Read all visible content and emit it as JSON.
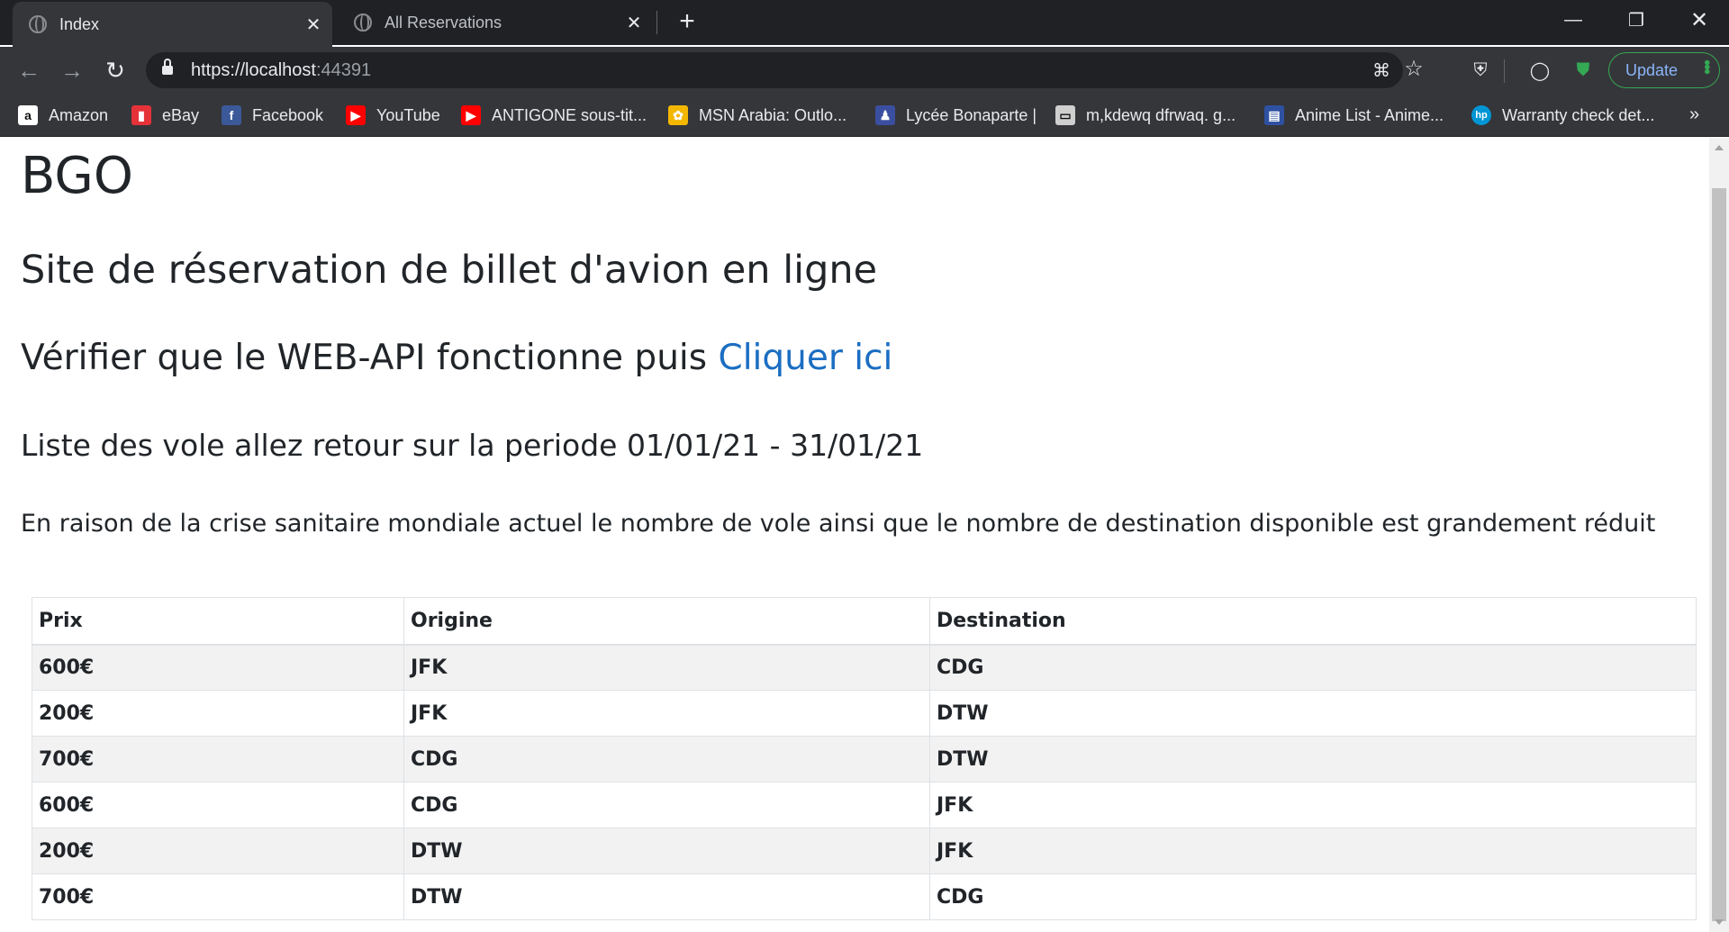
{
  "browser": {
    "tabs": [
      {
        "title": "Index",
        "active": true
      },
      {
        "title": "All Reservations",
        "active": false
      }
    ],
    "url": {
      "scheme": "https://",
      "host": "localhost",
      "port": ":44391"
    },
    "update_label": "Update",
    "bookmarks": [
      {
        "label": "Amazon",
        "icon": "amazon-icon",
        "color": "#ffffff"
      },
      {
        "label": "eBay",
        "icon": "ebay-icon",
        "color": "#e53238"
      },
      {
        "label": "Facebook",
        "icon": "facebook-icon",
        "color": "#3b5998"
      },
      {
        "label": "YouTube",
        "icon": "youtube-icon",
        "color": "#ff0000"
      },
      {
        "label": "ANTIGONE sous-tit...",
        "icon": "youtube-icon",
        "color": "#ff0000"
      },
      {
        "label": "MSN Arabia: Outlo...",
        "icon": "msn-icon",
        "color": "#f3b700"
      },
      {
        "label": "Lycée Bonaparte |",
        "icon": "lycee-icon",
        "color": "#3b4fa0"
      },
      {
        "label": "m,kdewq dfrwaq. g...",
        "icon": "pdf-icon",
        "color": "#cfcfcf"
      },
      {
        "label": "Anime List - Anime...",
        "icon": "anime-icon",
        "color": "#2e51a2"
      },
      {
        "label": "Warranty check det...",
        "icon": "hp-icon",
        "color": "#0096d6"
      }
    ]
  },
  "page": {
    "brand": "BGO",
    "site_title": "Site de réservation de billet d'avion en ligne",
    "check_text": "Vérifier que le WEB-API fonctionne puis ",
    "check_link": "Cliquer ici",
    "list_title": "Liste des vole allez retour sur la periode 01/01/21 - 31/01/21",
    "notice": "En raison de la crise sanitaire mondiale actuel le nombre de vole ainsi que le nombre de destination disponible est grandement réduit",
    "link_color": "#1b6ec2"
  },
  "table": {
    "headers": [
      "Prix",
      "Origine",
      "Destination"
    ],
    "rows": [
      [
        "600€",
        "JFK",
        "CDG"
      ],
      [
        "200€",
        "JFK",
        "DTW"
      ],
      [
        "700€",
        "CDG",
        "DTW"
      ],
      [
        "600€",
        "CDG",
        "JFK"
      ],
      [
        "200€",
        "DTW",
        "JFK"
      ],
      [
        "700€",
        "DTW",
        "CDG"
      ]
    ]
  }
}
